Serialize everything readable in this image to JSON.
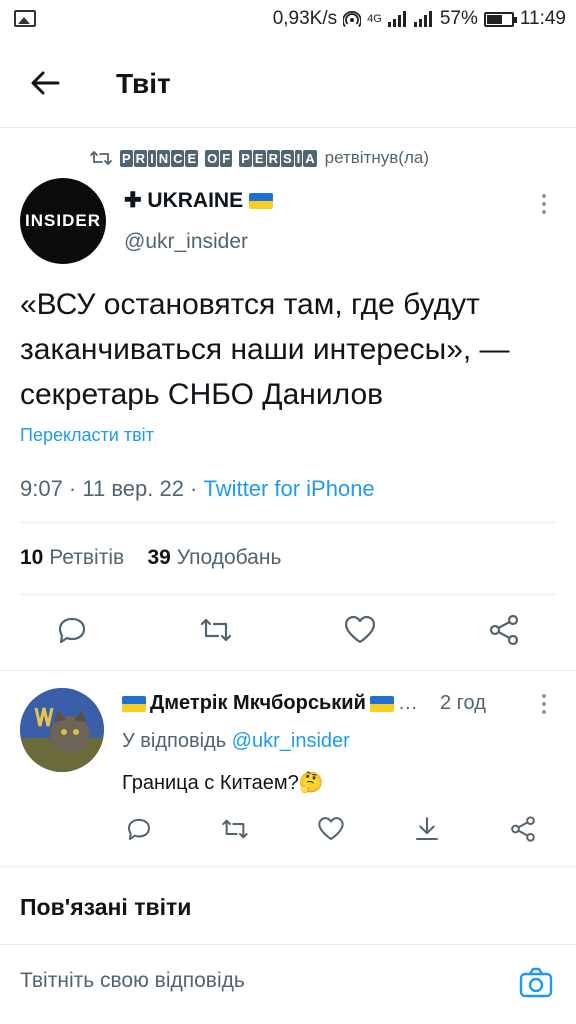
{
  "status_bar": {
    "speed": "0,93K/s",
    "network": "4G",
    "battery": "57%",
    "time": "11:49"
  },
  "header": {
    "title": "Твіт"
  },
  "retweet": {
    "retweeter_letters": [
      "P",
      "R",
      "I",
      "N",
      "C",
      "E",
      " ",
      "O",
      "F",
      " ",
      "P",
      "E",
      "R",
      "S",
      "I",
      "A"
    ],
    "suffix": "ретвітнув(ла)"
  },
  "tweet": {
    "author_name": "✚ UKRAINE",
    "handle": "@ukr_insider",
    "avatar_text": "INSIDER",
    "text": "«ВСУ остановятся там, где будут заканчиваться наши интересы», — секретарь СНБО Данилов",
    "translate": "Перекласти твіт",
    "timestamp": "9:07 · 11 вер. 22 · ",
    "source": "Twitter for iPhone",
    "retweets_count": "10",
    "retweets_label": "Ретвітів",
    "likes_count": "39",
    "likes_label": "Уподобань"
  },
  "reply": {
    "author_name": "Дметрік Мкчборський",
    "ellipsis": "…",
    "time": "2 год",
    "reply_prefix": "У відповідь ",
    "reply_handle": "@ukr_insider",
    "text": "Граница с Китаем?🤔"
  },
  "related": {
    "title": "Пов'язані твіти"
  },
  "compose": {
    "placeholder": "Твітніть свою відповідь"
  },
  "colors": {
    "accent": "#1d9bf0",
    "muted": "#536471",
    "text": "#0f1419",
    "border": "#e6ecf0"
  }
}
